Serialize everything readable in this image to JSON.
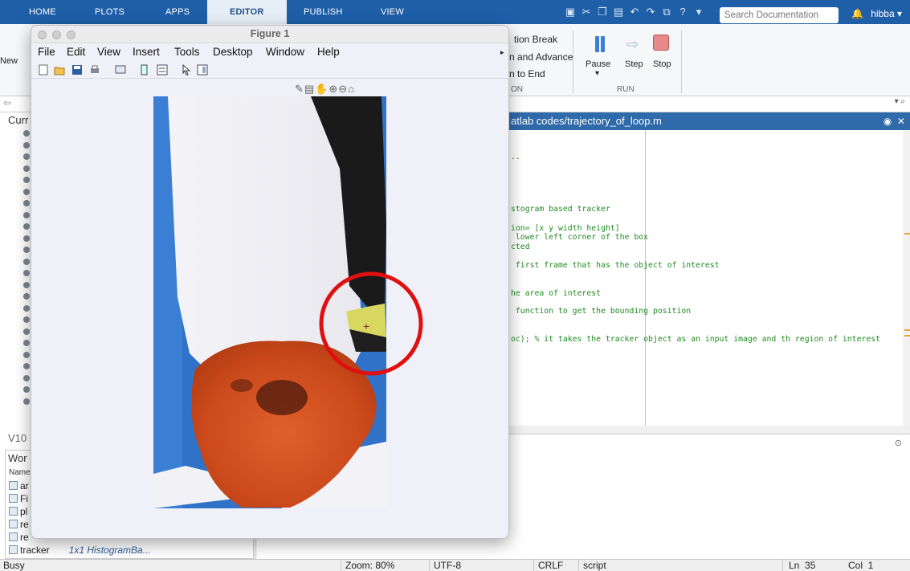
{
  "tabs": [
    {
      "label": "HOME"
    },
    {
      "label": "PLOTS"
    },
    {
      "label": "APPS"
    },
    {
      "label": "EDITOR"
    },
    {
      "label": "PUBLISH"
    },
    {
      "label": "VIEW"
    }
  ],
  "search": {
    "placeholder": "Search Documentation"
  },
  "user": {
    "name": "hibba"
  },
  "ribbon": {
    "new_label": "New",
    "run_section": {
      "items": [
        "tion Break",
        "n and Advance",
        "n to End"
      ],
      "section_label": "ON"
    },
    "pause_label": "Pause",
    "step_label": "Step",
    "stop_label": "Stop",
    "run_label": "RUN"
  },
  "current_folder": {
    "title": "Curr"
  },
  "version_label": "V10",
  "workspace": {
    "title": "Wor",
    "header": "Name",
    "rows": [
      {
        "name": "ar",
        "value": ""
      },
      {
        "name": "Fi",
        "value": ""
      },
      {
        "name": "pl",
        "value": ""
      },
      {
        "name": "re",
        "value": ""
      },
      {
        "name": "re",
        "value": ""
      },
      {
        "name": "tracker",
        "value": "1x1 HistogramBa..."
      }
    ]
  },
  "editor": {
    "title": "atlab codes/trajectory_of_loop.m",
    "lines": [
      "..",
      "stogram based tracker",
      "ion= [x y width height]",
      " lower left corner of the box",
      "cted",
      " first frame that has the object of interest",
      "he area of interest",
      " function to get the bounding position",
      "oc); % it takes the tracker object as an input image and th region of interest"
    ]
  },
  "figure": {
    "title": "Figure 1",
    "menu": [
      "File",
      "Edit",
      "View",
      "Insert",
      "Tools",
      "Desktop",
      "Window",
      "Help"
    ],
    "cursor_glyph": "+"
  },
  "status": {
    "state": "Busy",
    "zoom": "Zoom: 80%",
    "encoding": "UTF-8",
    "eol": "CRLF",
    "type": "script",
    "line": "Ln  35",
    "col": "Col  1"
  },
  "colors": {
    "tabbar": "#1f5fa8",
    "editor_title": "#2f6aaa",
    "annotation_circle": "#e01010",
    "comment_text": "#228b22"
  }
}
